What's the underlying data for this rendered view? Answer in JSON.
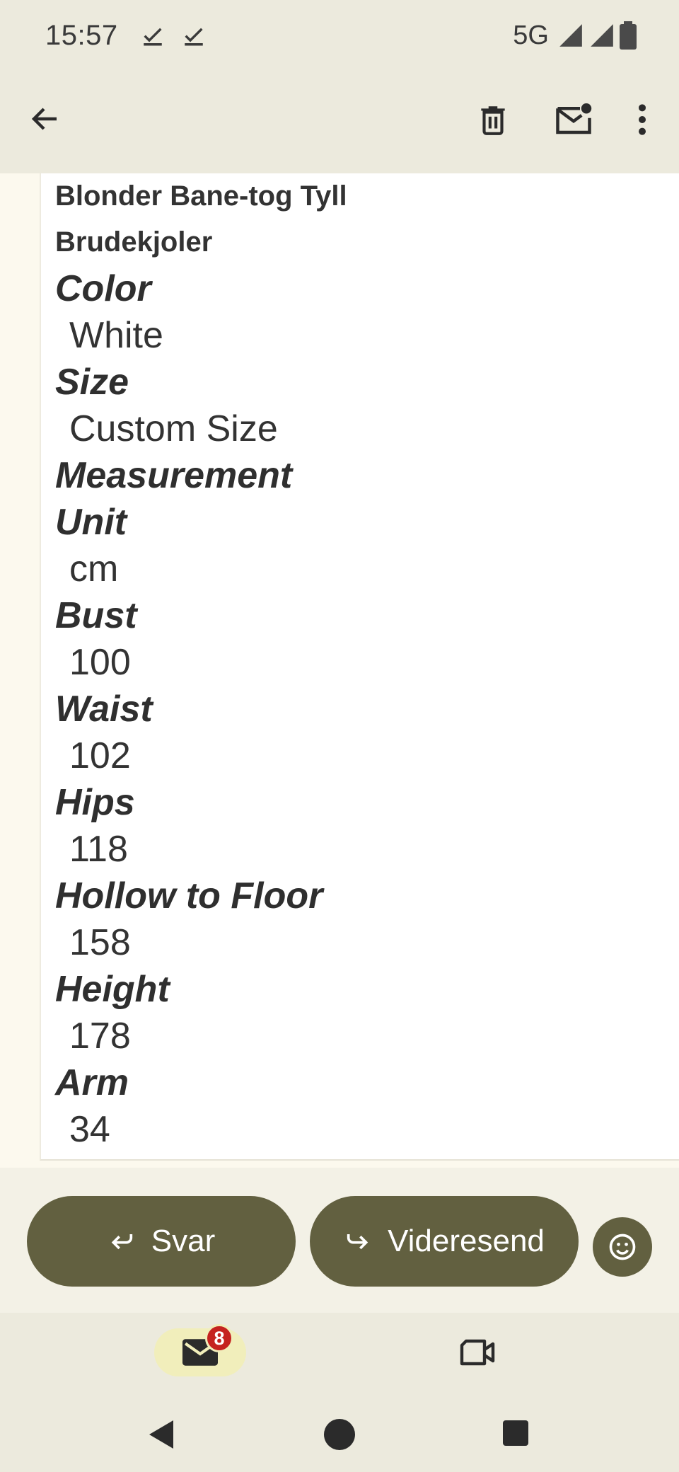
{
  "status_bar": {
    "time": "15:57",
    "network": "5G",
    "icons": [
      "check-icon",
      "check-icon",
      "signal-icon",
      "signal-icon",
      "battery-icon"
    ]
  },
  "app_bar": {
    "icons": [
      "back-arrow-icon",
      "trash-icon",
      "mark-unread-icon",
      "more-vert-icon"
    ]
  },
  "email": {
    "title_lines": [
      "Blonder Bane-tog Tyll",
      "Brudekjoler"
    ],
    "fields": [
      {
        "label": "Color",
        "value": "White"
      },
      {
        "label": "Size",
        "value": "Custom Size"
      },
      {
        "label": "Measurement",
        "value": ""
      },
      {
        "label": "Unit",
        "value": "cm"
      },
      {
        "label": "Bust",
        "value": "100"
      },
      {
        "label": "Waist",
        "value": "102"
      },
      {
        "label": "Hips",
        "value": "118"
      },
      {
        "label": "Hollow to Floor",
        "value": "158"
      },
      {
        "label": "Height",
        "value": "178"
      },
      {
        "label": "Arm",
        "value": "34"
      }
    ]
  },
  "reply_bar": {
    "reply_label": "Svar",
    "forward_label": "Videresend",
    "colors": {
      "pill": "#626040",
      "text": "#ffffff"
    }
  },
  "bottom_nav": {
    "mail_badge": "8",
    "colors": {
      "active_pill": "#f1eebb",
      "badge": "#c5221f"
    }
  }
}
